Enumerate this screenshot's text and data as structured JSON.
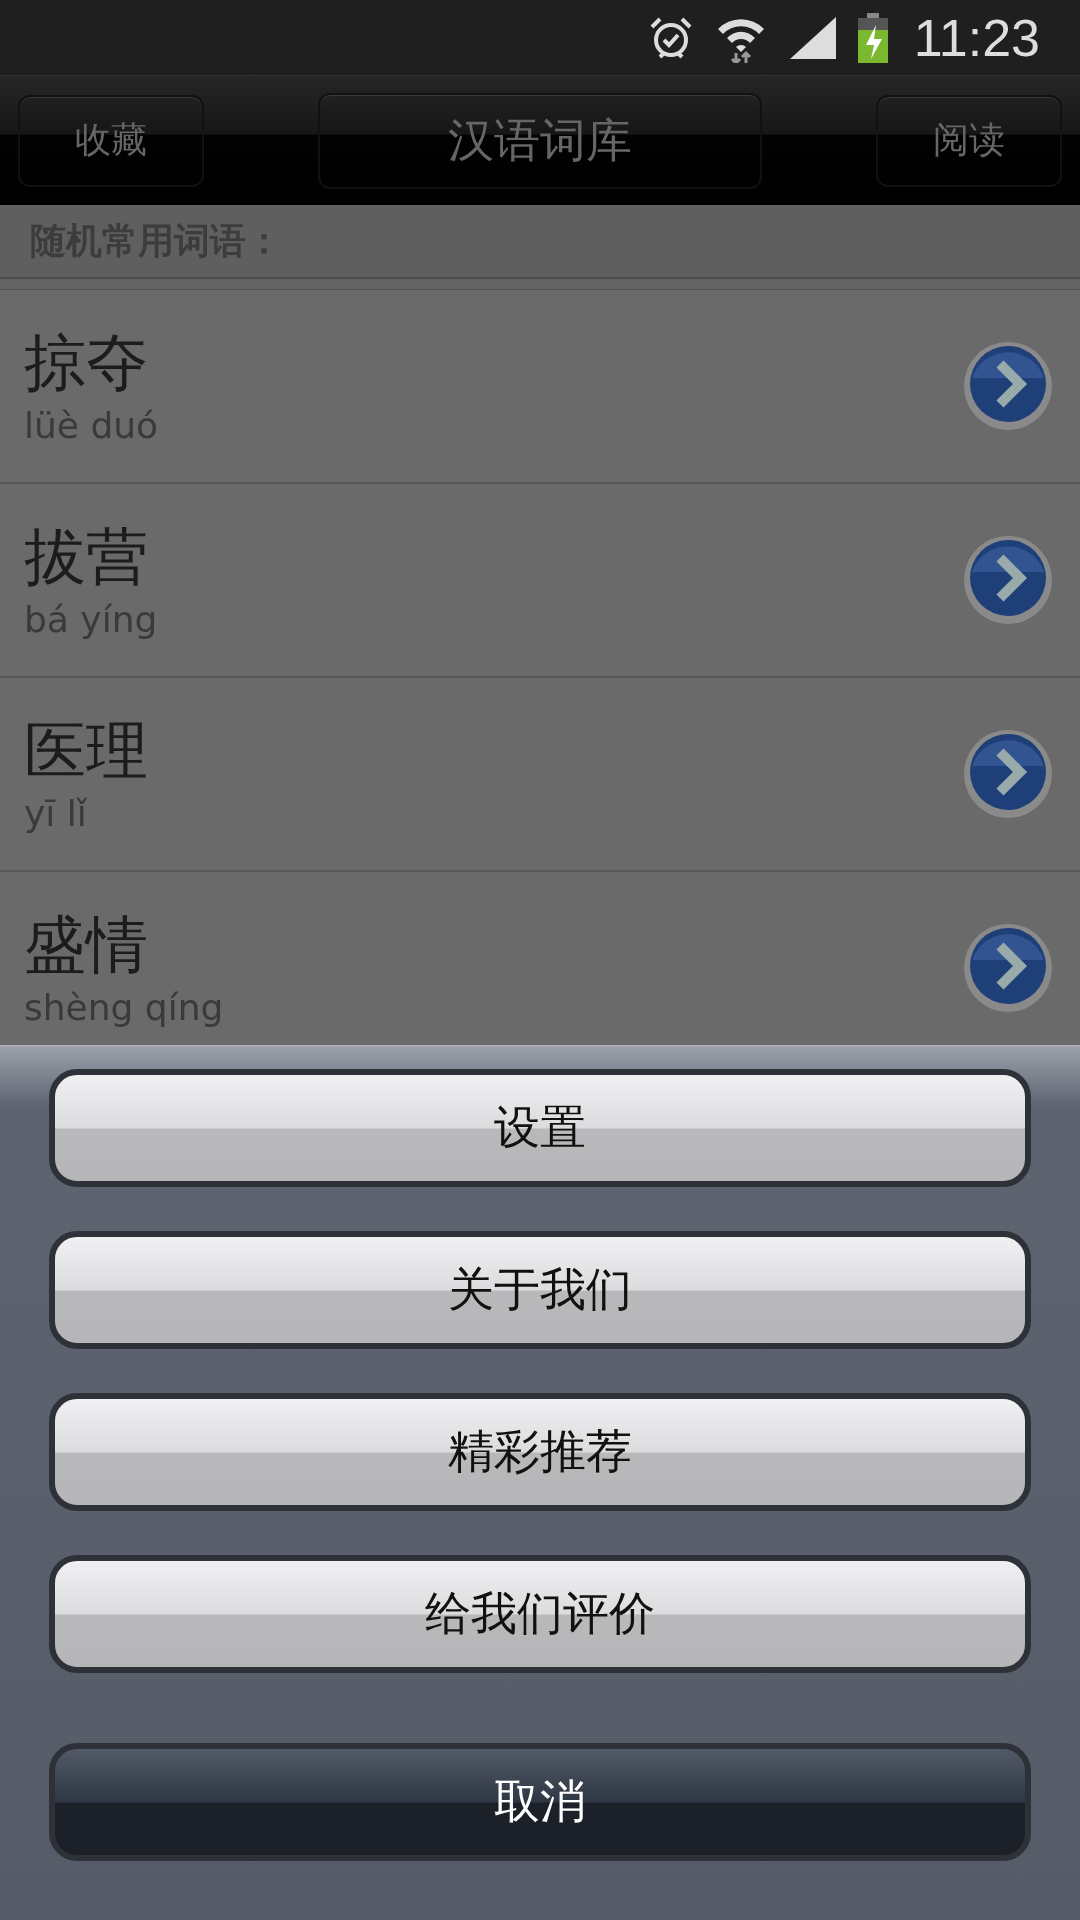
{
  "status_bar": {
    "time": "11:23"
  },
  "header": {
    "left_button": "收藏",
    "title": "汉语词库",
    "right_button": "阅读"
  },
  "section_label": "随机常用词语：",
  "words": [
    {
      "word": "掠夺",
      "pinyin": "lüè duó"
    },
    {
      "word": "拔营",
      "pinyin": "bá yíng"
    },
    {
      "word": "医理",
      "pinyin": "yī lǐ"
    },
    {
      "word": "盛情",
      "pinyin": "shèng qíng"
    }
  ],
  "action_sheet": {
    "buttons": [
      {
        "label": "设置",
        "kind": "normal"
      },
      {
        "label": "关于我们",
        "kind": "normal"
      },
      {
        "label": "精彩推荐",
        "kind": "normal"
      },
      {
        "label": "给我们评价",
        "kind": "normal"
      },
      {
        "label": "取消",
        "kind": "cancel"
      }
    ]
  }
}
